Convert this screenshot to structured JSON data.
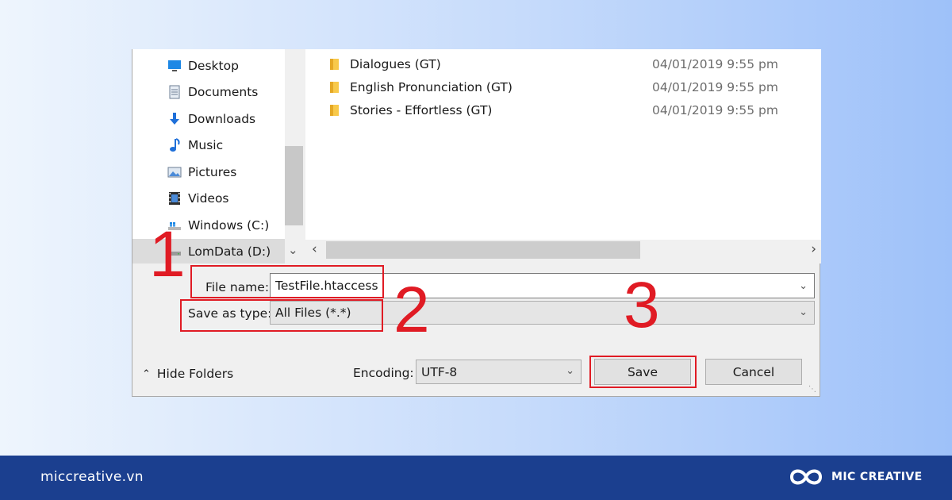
{
  "nav": {
    "items": [
      {
        "label": "Desktop",
        "icon": "desktop-icon"
      },
      {
        "label": "Documents",
        "icon": "documents-icon"
      },
      {
        "label": "Downloads",
        "icon": "downloads-icon"
      },
      {
        "label": "Music",
        "icon": "music-icon"
      },
      {
        "label": "Pictures",
        "icon": "pictures-icon"
      },
      {
        "label": "Videos",
        "icon": "videos-icon"
      },
      {
        "label": "Windows (C:)",
        "icon": "drive-icon"
      },
      {
        "label": "LomData (D:)",
        "icon": "drive-icon"
      }
    ]
  },
  "files": [
    {
      "name": "Dialogues (GT)",
      "date": "04/01/2019 9:55 pm"
    },
    {
      "name": "English Pronunciation (GT)",
      "date": "04/01/2019 9:55 pm"
    },
    {
      "name": "Stories - Effortless (GT)",
      "date": "04/01/2019 9:55 pm"
    }
  ],
  "form": {
    "file_name_label": "File name:",
    "file_name_value": "TestFile.htaccess",
    "save_type_label": "Save as type:",
    "save_type_value": "All Files  (*.*)",
    "encoding_label": "Encoding:",
    "encoding_value": "UTF-8"
  },
  "buttons": {
    "hide_folders": "Hide Folders",
    "save": "Save",
    "cancel": "Cancel"
  },
  "annotations": {
    "step1": "1",
    "step2": "2",
    "step3": "3",
    "highlight_color": "#e01b24"
  },
  "footer": {
    "url": "miccreative.vn",
    "brand": "MIC CREATIVE",
    "color": "#1b3f8f"
  }
}
